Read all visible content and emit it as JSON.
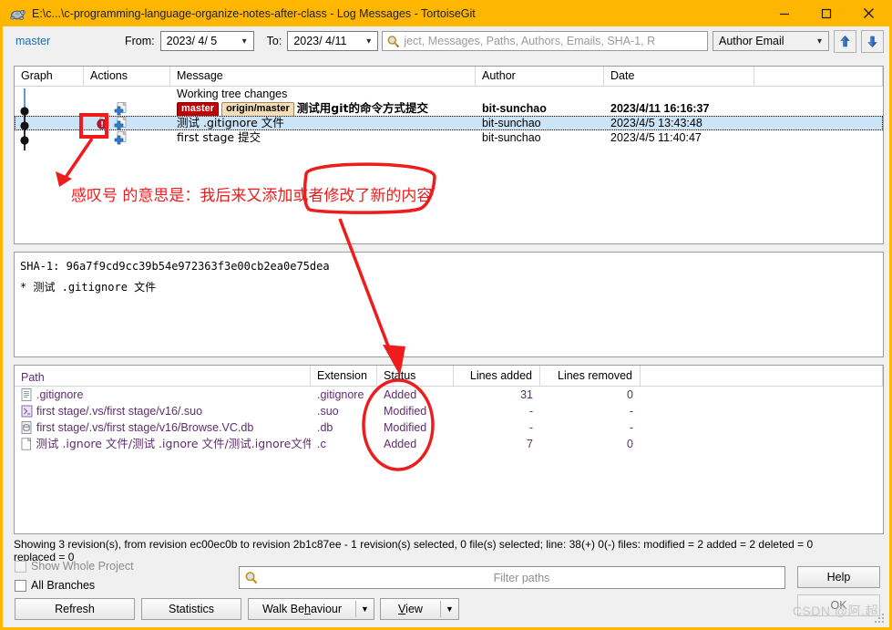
{
  "window": {
    "title": "E:\\c...\\c-programming-language-organize-notes-after-class - Log Messages - TortoiseGit",
    "icon": "tortoisegit-icon",
    "minimize_label": "—",
    "maximize_label": "□",
    "close_label": "✕",
    "titlebar_color": "#ffb600"
  },
  "toolbar": {
    "branch": "master",
    "from_label": "From:",
    "from_value": "2023/ 4/ 5",
    "to_label": "To:",
    "to_value": "2023/ 4/11",
    "search_placeholder": "ject, Messages, Paths, Authors, Emails, SHA-1, R",
    "filter_mode": "Author Email",
    "up_arrow": "up-arrow-icon",
    "down_arrow": "down-arrow-icon"
  },
  "log_list": {
    "columns": [
      "Graph",
      "Actions",
      "Message",
      "Author",
      "Date"
    ],
    "rows": [
      {
        "message": "Working tree changes",
        "author": "",
        "date": "",
        "refs": [],
        "bold": false,
        "selected": false,
        "actions": []
      },
      {
        "message": "测试用git的命令方式提交",
        "author": "bit-sunchao",
        "date": "2023/4/11 16:16:37",
        "refs": [
          {
            "name": "master",
            "kind": "local"
          },
          {
            "name": "origin/master",
            "kind": "remote"
          }
        ],
        "bold": true,
        "selected": false,
        "actions": [
          "added-file-icon"
        ]
      },
      {
        "message": "测试 .gitignore 文件",
        "author": "bit-sunchao",
        "date": "2023/4/5 13:43:48",
        "refs": [],
        "bold": false,
        "selected": true,
        "actions": [
          "modified-warning-icon",
          "added-file-icon"
        ]
      },
      {
        "message": "first stage 提交",
        "author": "bit-sunchao",
        "date": "2023/4/5 11:40:47",
        "refs": [],
        "bold": false,
        "selected": false,
        "actions": [
          "added-file-icon"
        ]
      }
    ]
  },
  "commit_detail": {
    "sha_label": "SHA-1:",
    "sha_value": "96a7f9cd9cc39b54e972363f3e00cb2ea0e75dea",
    "subject": "* 测试 .gitignore 文件"
  },
  "file_list": {
    "columns": [
      "Path",
      "Extension",
      "Status",
      "Lines added",
      "Lines removed"
    ],
    "rows": [
      {
        "icon": "text-file-icon",
        "path": ".gitignore",
        "extension": ".gitignore",
        "status": "Added",
        "lines_added": "31",
        "lines_removed": "0"
      },
      {
        "icon": "vs-solution-user-options-icon",
        "path": "first stage/.vs/first stage/v16/.suo",
        "extension": ".suo",
        "status": "Modified",
        "lines_added": "-",
        "lines_removed": "-"
      },
      {
        "icon": "database-file-icon",
        "path": "first stage/.vs/first stage/v16/Browse.VC.db",
        "extension": ".db",
        "status": "Modified",
        "lines_added": "-",
        "lines_removed": "-"
      },
      {
        "icon": "c-source-file-icon",
        "path": "测试 .ignore 文件/测试 .ignore 文件/测试.ignore文件.c",
        "extension": ".c",
        "status": "Added",
        "lines_added": "7",
        "lines_removed": "0"
      }
    ]
  },
  "status_bar": {
    "line1": "Showing 3 revision(s), from revision ec00ec0b to revision 2b1c87ee - 1 revision(s) selected, 0 file(s) selected; line: 38(+) 0(-) files: modified = 2 added = 2 deleted = 0",
    "line2": "replaced = 0"
  },
  "bottom": {
    "show_whole_project": "Show Whole Project",
    "all_branches": "All Branches",
    "refresh": "Refresh",
    "statistics": "Statistics",
    "walk_behaviour_pre": "Walk Be",
    "walk_behaviour_mnemonic": "h",
    "walk_behaviour_post": "aviour",
    "view_mnemonic": "V",
    "view_post": "iew",
    "filter_placeholder": "Filter paths",
    "help": "Help",
    "ok": "OK"
  },
  "annotations": {
    "note": "感叹号 的意思是：我后来又添加或者修改了新的内容",
    "color": "#ee1c1c"
  },
  "watermark": "CSDN @阿.超"
}
